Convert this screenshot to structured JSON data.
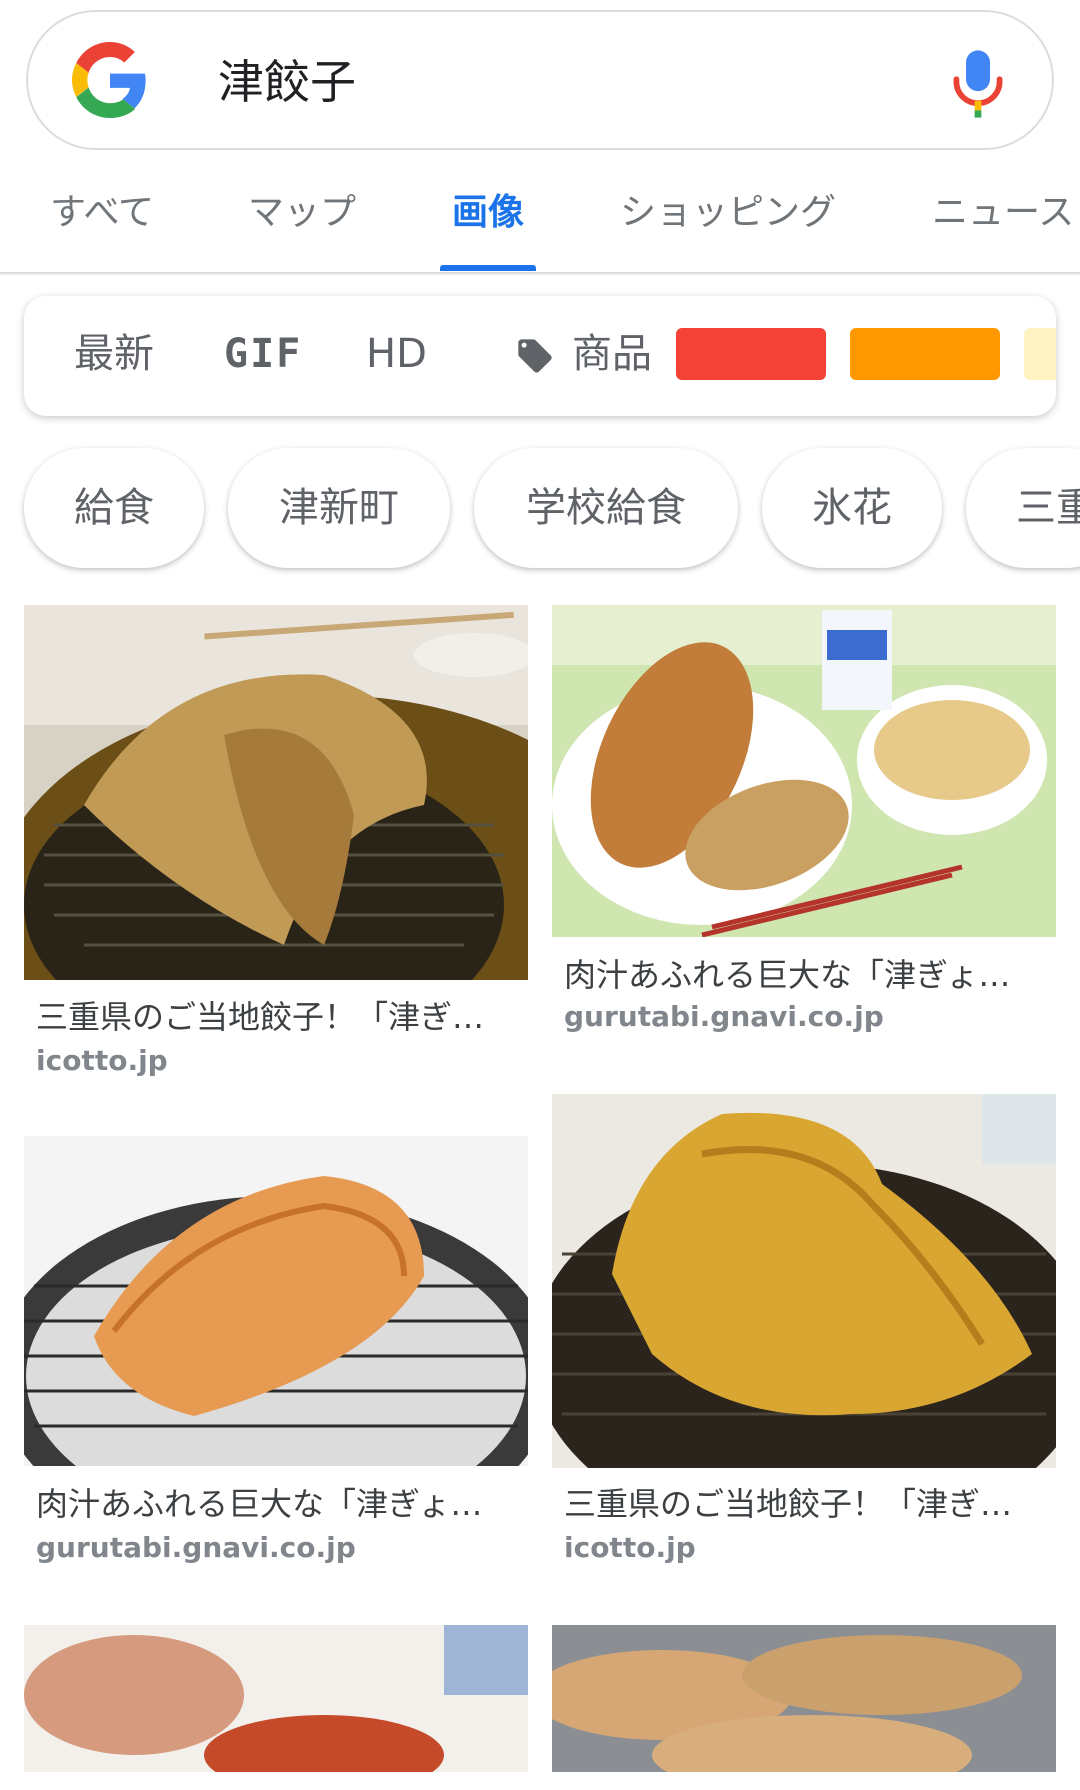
{
  "search": {
    "query": "津餃子"
  },
  "tabs": [
    {
      "label": "すべて"
    },
    {
      "label": "マップ"
    },
    {
      "label": "画像"
    },
    {
      "label": "ショッピング"
    },
    {
      "label": "ニュース"
    }
  ],
  "filters": {
    "latest": "最新",
    "gif": "GIF",
    "hd": "HD",
    "product": "商品",
    "colors": [
      "#f44336",
      "#ff9800",
      "#fff3c4"
    ]
  },
  "chips": [
    {
      "label": "給食"
    },
    {
      "label": "津新町"
    },
    {
      "label": "学校給食"
    },
    {
      "label": "氷花"
    },
    {
      "label": "三重"
    }
  ],
  "results": [
    {
      "title": "三重県のご当地餃子！「津ぎ…",
      "source": "icotto.jp"
    },
    {
      "title": "肉汁あふれる巨大な「津ぎょ…",
      "source": "gurutabi.gnavi.co.jp"
    },
    {
      "title": "肉汁あふれる巨大な「津ぎょ…",
      "source": "gurutabi.gnavi.co.jp"
    },
    {
      "title": "三重県のご当地餃子！「津ぎ…",
      "source": "icotto.jp"
    }
  ]
}
